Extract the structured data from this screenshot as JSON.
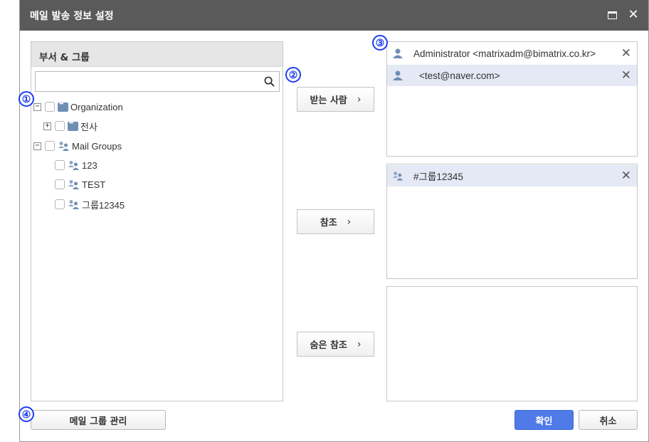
{
  "dialog": {
    "title": "메일 발송 정보 설정",
    "maximize_icon": "maximize-icon",
    "close_icon": "close-icon"
  },
  "left_panel": {
    "header": "부서 & 그룹",
    "search": {
      "value": "",
      "placeholder": ""
    },
    "tree": [
      {
        "label": "Organization",
        "expander": "−",
        "icon": "organization-icon"
      },
      {
        "label": "전사",
        "expander": "+",
        "icon": "organization-icon"
      },
      {
        "label": "Mail Groups",
        "expander": "−",
        "icon": "group-icon"
      },
      {
        "label": "123",
        "icon": "group-icon"
      },
      {
        "label": "TEST",
        "icon": "group-icon"
      },
      {
        "label": "그룹12345",
        "icon": "group-icon"
      }
    ]
  },
  "middle": {
    "to_button": "받는 사람",
    "cc_button": "참조",
    "bcc_button": "숨은 참조",
    "arrow": "›"
  },
  "recipients": {
    "to": [
      {
        "text": "Administrator <matrixadm@bimatrix.co.kr>",
        "icon": "person-icon",
        "selected": false
      },
      {
        "text": "<test@naver.com>",
        "icon": "person-icon",
        "selected": true
      }
    ],
    "cc": [
      {
        "text": "#그룹12345",
        "icon": "group-icon",
        "selected": true
      }
    ],
    "bcc": []
  },
  "footer": {
    "manage_groups": "메일 그룹 관리",
    "confirm": "확인",
    "cancel": "취소"
  },
  "markers": [
    "①",
    "②",
    "③",
    "④"
  ],
  "colors": {
    "titlebar": "#5a5a5a",
    "primary": "#4f7ae8",
    "selection": "#e4e9f5",
    "icon_blue": "#6f8eb4",
    "marker": "#1f3df0"
  }
}
